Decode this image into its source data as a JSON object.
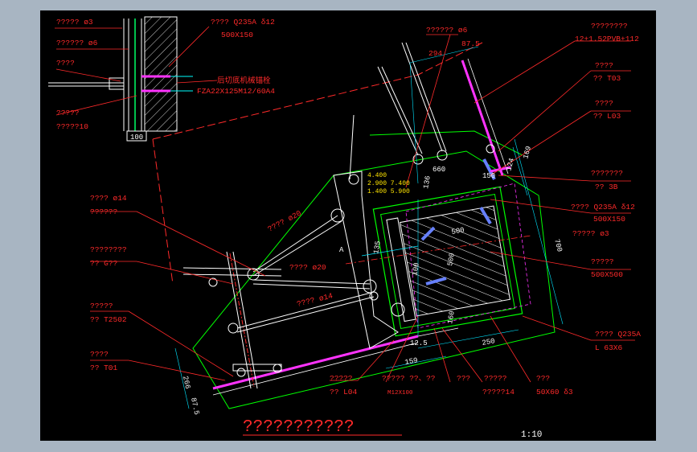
{
  "drawing": {
    "title": "???????????",
    "scale": "1:10",
    "labels": {
      "tl1": "?????  ø3",
      "tl2": "??????  ø6",
      "tl3": "????",
      "tl4": "?????",
      "tl5": "?????10",
      "tr1": "????  Q235A  δ12",
      "tr2": "500X150",
      "tr3": "FZA22X125M12/60A4",
      "tr4": "后切底机械锚栓",
      "t6a": "??????  ø6",
      "t8a": "????????",
      "t8b": "12+1.52PVB+112",
      "r1a": "????",
      "r1b": "??  T03",
      "r2a": "????",
      "r2b": "??  L03",
      "r3a": "???????",
      "r3b": "??  3B",
      "r4a": "????  Q235A  δ12",
      "r4b": "500X150",
      "r4c": "?????  ø3",
      "r5a": "?????",
      "r5b": "500X500",
      "r6a": "????  Q235A",
      "r6b": "L 63X6",
      "l1a": "????  ø14",
      "l1b": "??????",
      "l2a": "????????",
      "l2b": "??  G??",
      "l3a": "?????",
      "l3b": "??  T2502",
      "l4a": "????",
      "l4b": "??  T01",
      "c1": "????  ø20",
      "c2": "????  ø20",
      "c3": "????  ø14",
      "b1a": "?????",
      "b1b": "??  L04",
      "b1c": "M12X100",
      "b2a": "?????  ??、??",
      "b3a": "???",
      "b4a": "?????",
      "b4b": "?????14",
      "b5a": "???",
      "b5b": "50X60  δ3",
      "letter_a": "A"
    },
    "dims": {
      "d100": "100",
      "d294": "294",
      "d875": "87.5",
      "d660": "660",
      "d136": "136",
      "d150": "150",
      "d169": "169",
      "d124": "124",
      "d500a": "500",
      "d500b": "500",
      "d700": "700",
      "d135": "135",
      "d100b": "100",
      "d160": "160",
      "d125": "12.5",
      "d250": "250",
      "d159": "159",
      "d266": "266",
      "d875b": "87.5"
    },
    "elevations": [
      "4.400",
      "2.900  7.400",
      "1.400  5.900"
    ],
    "colors": {
      "background": "#000000",
      "frame": "#a8b5c2",
      "label": "#ff2a2a",
      "dim": "#00e5ff"
    }
  }
}
